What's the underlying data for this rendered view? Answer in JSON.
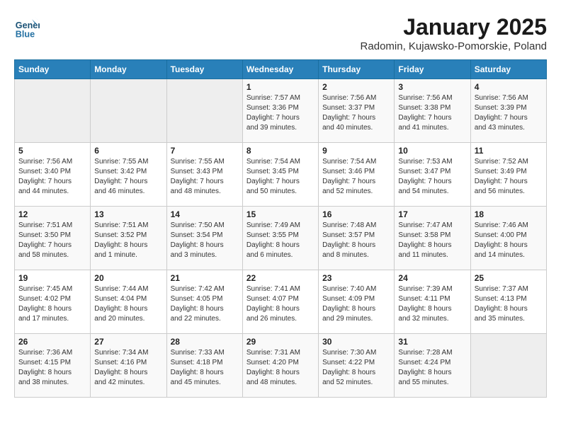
{
  "header": {
    "logo_line1": "General",
    "logo_line2": "Blue",
    "month": "January 2025",
    "location": "Radomin, Kujawsko-Pomorskie, Poland"
  },
  "weekdays": [
    "Sunday",
    "Monday",
    "Tuesday",
    "Wednesday",
    "Thursday",
    "Friday",
    "Saturday"
  ],
  "weeks": [
    [
      {
        "day": "",
        "info": ""
      },
      {
        "day": "",
        "info": ""
      },
      {
        "day": "",
        "info": ""
      },
      {
        "day": "1",
        "info": "Sunrise: 7:57 AM\nSunset: 3:36 PM\nDaylight: 7 hours\nand 39 minutes."
      },
      {
        "day": "2",
        "info": "Sunrise: 7:56 AM\nSunset: 3:37 PM\nDaylight: 7 hours\nand 40 minutes."
      },
      {
        "day": "3",
        "info": "Sunrise: 7:56 AM\nSunset: 3:38 PM\nDaylight: 7 hours\nand 41 minutes."
      },
      {
        "day": "4",
        "info": "Sunrise: 7:56 AM\nSunset: 3:39 PM\nDaylight: 7 hours\nand 43 minutes."
      }
    ],
    [
      {
        "day": "5",
        "info": "Sunrise: 7:56 AM\nSunset: 3:40 PM\nDaylight: 7 hours\nand 44 minutes."
      },
      {
        "day": "6",
        "info": "Sunrise: 7:55 AM\nSunset: 3:42 PM\nDaylight: 7 hours\nand 46 minutes."
      },
      {
        "day": "7",
        "info": "Sunrise: 7:55 AM\nSunset: 3:43 PM\nDaylight: 7 hours\nand 48 minutes."
      },
      {
        "day": "8",
        "info": "Sunrise: 7:54 AM\nSunset: 3:45 PM\nDaylight: 7 hours\nand 50 minutes."
      },
      {
        "day": "9",
        "info": "Sunrise: 7:54 AM\nSunset: 3:46 PM\nDaylight: 7 hours\nand 52 minutes."
      },
      {
        "day": "10",
        "info": "Sunrise: 7:53 AM\nSunset: 3:47 PM\nDaylight: 7 hours\nand 54 minutes."
      },
      {
        "day": "11",
        "info": "Sunrise: 7:52 AM\nSunset: 3:49 PM\nDaylight: 7 hours\nand 56 minutes."
      }
    ],
    [
      {
        "day": "12",
        "info": "Sunrise: 7:51 AM\nSunset: 3:50 PM\nDaylight: 7 hours\nand 58 minutes."
      },
      {
        "day": "13",
        "info": "Sunrise: 7:51 AM\nSunset: 3:52 PM\nDaylight: 8 hours\nand 1 minute."
      },
      {
        "day": "14",
        "info": "Sunrise: 7:50 AM\nSunset: 3:54 PM\nDaylight: 8 hours\nand 3 minutes."
      },
      {
        "day": "15",
        "info": "Sunrise: 7:49 AM\nSunset: 3:55 PM\nDaylight: 8 hours\nand 6 minutes."
      },
      {
        "day": "16",
        "info": "Sunrise: 7:48 AM\nSunset: 3:57 PM\nDaylight: 8 hours\nand 8 minutes."
      },
      {
        "day": "17",
        "info": "Sunrise: 7:47 AM\nSunset: 3:58 PM\nDaylight: 8 hours\nand 11 minutes."
      },
      {
        "day": "18",
        "info": "Sunrise: 7:46 AM\nSunset: 4:00 PM\nDaylight: 8 hours\nand 14 minutes."
      }
    ],
    [
      {
        "day": "19",
        "info": "Sunrise: 7:45 AM\nSunset: 4:02 PM\nDaylight: 8 hours\nand 17 minutes."
      },
      {
        "day": "20",
        "info": "Sunrise: 7:44 AM\nSunset: 4:04 PM\nDaylight: 8 hours\nand 20 minutes."
      },
      {
        "day": "21",
        "info": "Sunrise: 7:42 AM\nSunset: 4:05 PM\nDaylight: 8 hours\nand 22 minutes."
      },
      {
        "day": "22",
        "info": "Sunrise: 7:41 AM\nSunset: 4:07 PM\nDaylight: 8 hours\nand 26 minutes."
      },
      {
        "day": "23",
        "info": "Sunrise: 7:40 AM\nSunset: 4:09 PM\nDaylight: 8 hours\nand 29 minutes."
      },
      {
        "day": "24",
        "info": "Sunrise: 7:39 AM\nSunset: 4:11 PM\nDaylight: 8 hours\nand 32 minutes."
      },
      {
        "day": "25",
        "info": "Sunrise: 7:37 AM\nSunset: 4:13 PM\nDaylight: 8 hours\nand 35 minutes."
      }
    ],
    [
      {
        "day": "26",
        "info": "Sunrise: 7:36 AM\nSunset: 4:15 PM\nDaylight: 8 hours\nand 38 minutes."
      },
      {
        "day": "27",
        "info": "Sunrise: 7:34 AM\nSunset: 4:16 PM\nDaylight: 8 hours\nand 42 minutes."
      },
      {
        "day": "28",
        "info": "Sunrise: 7:33 AM\nSunset: 4:18 PM\nDaylight: 8 hours\nand 45 minutes."
      },
      {
        "day": "29",
        "info": "Sunrise: 7:31 AM\nSunset: 4:20 PM\nDaylight: 8 hours\nand 48 minutes."
      },
      {
        "day": "30",
        "info": "Sunrise: 7:30 AM\nSunset: 4:22 PM\nDaylight: 8 hours\nand 52 minutes."
      },
      {
        "day": "31",
        "info": "Sunrise: 7:28 AM\nSunset: 4:24 PM\nDaylight: 8 hours\nand 55 minutes."
      },
      {
        "day": "",
        "info": ""
      }
    ]
  ]
}
